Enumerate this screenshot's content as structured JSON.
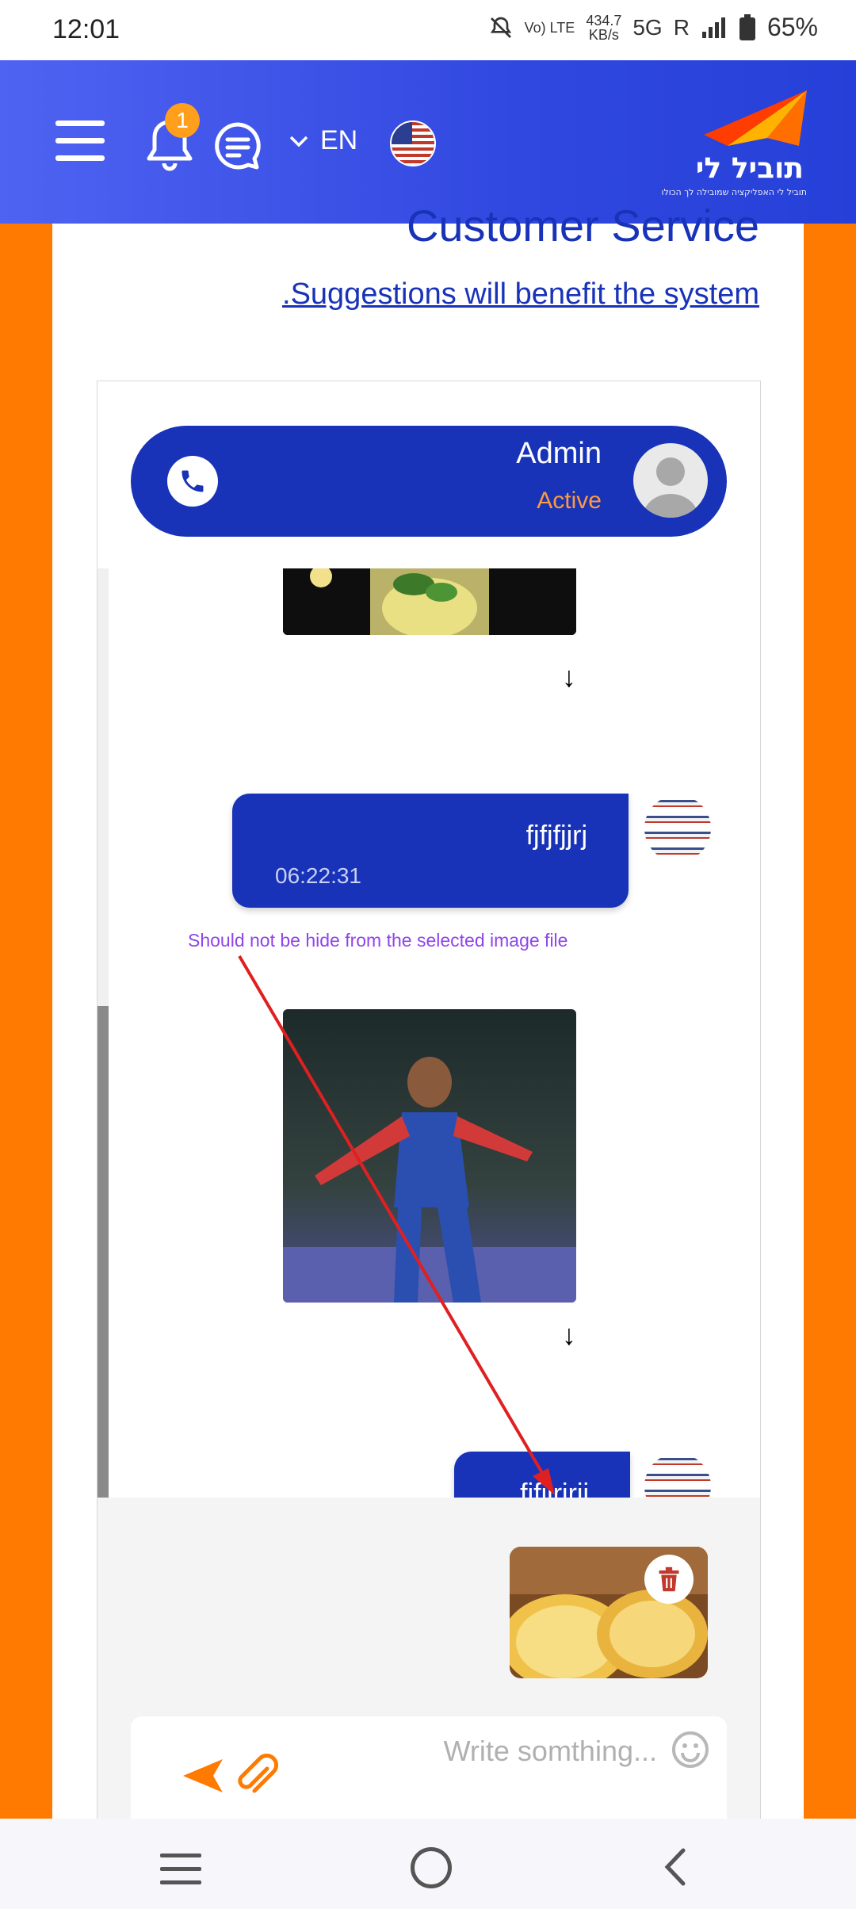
{
  "status_bar": {
    "time": "12:01",
    "volte": "Vo) LTE",
    "speed_value": "434.7",
    "speed_unit": "KB/s",
    "network": "5G",
    "roaming": "R",
    "battery": "65%"
  },
  "header": {
    "notification_count": "1",
    "language": "EN",
    "logo_text": "תוביל לי",
    "logo_subtitle": "תוביל לי האפליקציה שמובילה לך הכולו"
  },
  "page": {
    "title": "Customer Service",
    "suggestion_link": ".Suggestions will benefit the system"
  },
  "chat": {
    "contact_name": "Admin",
    "contact_status": "Active",
    "messages": [
      {
        "text": "fjfjfjjrj",
        "time": "06:22:31"
      },
      {
        "text": "fjfjjrjrjj",
        "time": ""
      }
    ],
    "annotation": "Should not be hide from the selected image file",
    "input_placeholder": "Write somthing..."
  },
  "colors": {
    "primary_blue": "#1833b8",
    "accent_orange": "#ff7a00",
    "status_active": "#ff9a3c",
    "annotation_purple": "#8e44ec",
    "arrow_red": "#e02020"
  }
}
